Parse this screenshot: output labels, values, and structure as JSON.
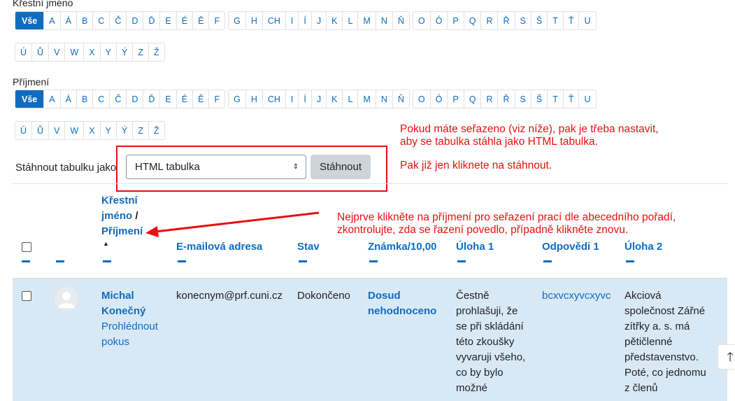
{
  "first_name_label": "Křestní jméno",
  "last_name_label": "Příjmení",
  "all_label": "Vše",
  "alphabet_row1": [
    [
      "A",
      "Á",
      "B",
      "C",
      "Č",
      "D",
      "Ď",
      "E",
      "É",
      "Ě",
      "F"
    ],
    [
      "G",
      "H",
      "CH",
      "I",
      "Í",
      "J",
      "K",
      "L",
      "M",
      "N",
      "Ň"
    ],
    [
      "O",
      "Ó",
      "P",
      "Q",
      "R",
      "Ř",
      "S",
      "Š",
      "T",
      "Ť",
      "U"
    ]
  ],
  "alphabet_row2": [
    "Ú",
    "Ů",
    "V",
    "W",
    "X",
    "Y",
    "Ý",
    "Z",
    "Ž"
  ],
  "download": {
    "label": "Stáhnout tabulku jako",
    "selected": "HTML tabulka",
    "button": "Stáhnout"
  },
  "notes": {
    "n1_line1": "Pokud máte seřazeno (viz níže), pak je třeba nastavit,",
    "n1_line2": "aby se tabulka stáhla jako HTML tabulka.",
    "n2": "Pak již jen kliknete na stáhnout.",
    "n3_line1": "Nejprve klikněte na příjmení pro seřazení prací dle abecedního pořadí,",
    "n3_line2": "zkontrolujte, zda se řazení povedlo, případně klikněte znovu."
  },
  "table": {
    "headers": {
      "first_name_1": "Křestní",
      "first_name_2": "jméno",
      "sep": "/",
      "last_name": "Příjmení",
      "sort_indicator": "▲",
      "email": "E-mailová adresa",
      "status": "Stav",
      "grade": "Známka/10,00",
      "q1": "Úloha 1",
      "response1": "Odpovědi 1",
      "q2": "Úloha 2"
    },
    "row": {
      "first_name": "Michal",
      "last_name": "Konečný",
      "review_1": "Prohlédnout",
      "review_2": "pokus",
      "email": "konecnym@prf.cuni.cz",
      "status": "Dokončeno",
      "grade_1": "Dosud",
      "grade_2": "nehodnoceno",
      "q1_lines": [
        "Čestně",
        "prohlašuji, že",
        "se při skládání",
        "této zkoušky",
        "vyvaruji všeho,",
        "co by bylo",
        "možné"
      ],
      "response1": "bcxvcxyvcxyvc",
      "q2_lines": [
        "Akciová",
        "společnost Zářné",
        "zítřky a. s. má",
        "pětičlenné",
        "představenstvo.",
        "Poté, co jednomu",
        "z členů"
      ]
    }
  },
  "icons": {
    "select_caret": "⇕",
    "scroll_top": "🡑"
  },
  "colors": {
    "accent": "#0f6cbf",
    "annotation_red": "#e81010",
    "row_highlight": "#d8e8f5"
  }
}
